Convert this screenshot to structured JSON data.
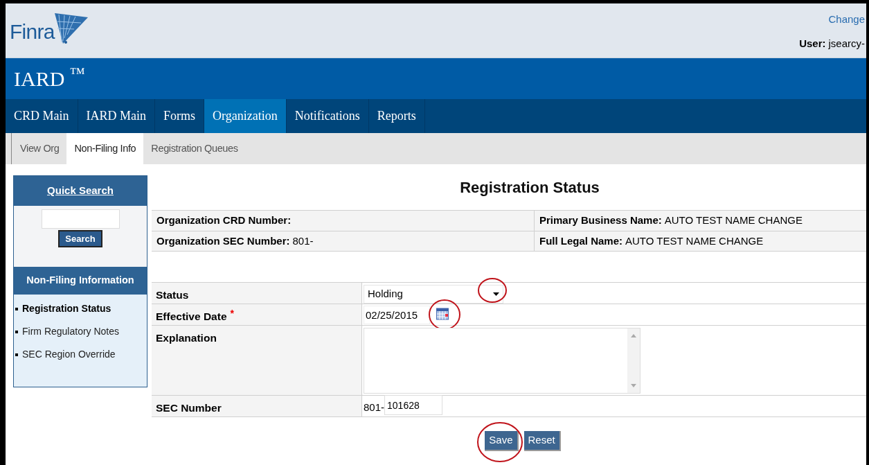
{
  "header": {
    "logo": "Finra",
    "link": "Change",
    "user_label": "User:",
    "user_value": "jsearcy-"
  },
  "app": {
    "title": "IARD",
    "mark": "™"
  },
  "nav": [
    {
      "label": "CRD Main",
      "selected": false
    },
    {
      "label": "IARD Main",
      "selected": false
    },
    {
      "label": "Forms",
      "selected": false
    },
    {
      "label": "Organization",
      "selected": true
    },
    {
      "label": "Notifications",
      "selected": false
    },
    {
      "label": "Reports",
      "selected": false
    }
  ],
  "subnav": [
    {
      "label": "View Org",
      "selected": false
    },
    {
      "label": "Non-Filing Info",
      "selected": true
    },
    {
      "label": "Registration Queues",
      "selected": false
    }
  ],
  "sidebar": {
    "quick_search": {
      "title": "Quick Search",
      "button": "Search"
    },
    "section_title": "Non-Filing Information",
    "items": [
      {
        "label": "Registration Status",
        "selected": true
      },
      {
        "label": "Firm Regulatory Notes",
        "selected": false
      },
      {
        "label": "SEC Region Override",
        "selected": false
      }
    ]
  },
  "page_title": "Registration Status",
  "info_rows": [
    [
      {
        "label": "Organization CRD Number:"
      },
      {
        "label": "Primary Business Name:",
        "value": "AUTO TEST NAME CHANGE"
      }
    ],
    [
      {
        "label": "Organization SEC Number:",
        "value": "801-"
      },
      {
        "label": "Full Legal Name:",
        "value": "AUTO TEST NAME CHANGE"
      }
    ]
  ],
  "form": [
    {
      "kind": "select",
      "label": "Status",
      "value": "Holding",
      "circled": true
    },
    {
      "kind": "date",
      "label": "Effective Date",
      "required": true,
      "required_mark": "*",
      "value": "02/25/2015",
      "circled": true
    },
    {
      "kind": "textarea",
      "label": "Explanation"
    },
    {
      "kind": "prefixed",
      "label": "SEC Number",
      "prefix": "801-",
      "value": "101628"
    }
  ],
  "buttons": [
    {
      "label": "Save",
      "circled": true
    },
    {
      "label": "Reset",
      "circled": false
    }
  ]
}
